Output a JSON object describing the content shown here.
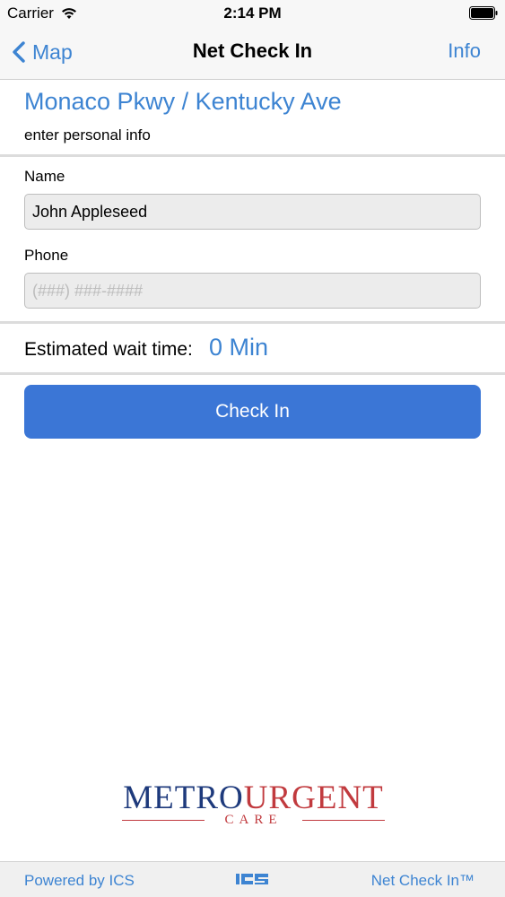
{
  "status_bar": {
    "carrier": "Carrier",
    "time": "2:14 PM",
    "wifi_icon": "wifi-icon",
    "battery_icon": "battery-icon"
  },
  "nav": {
    "back_label": "Map",
    "back_icon": "chevron-left-icon",
    "title": "Net Check In",
    "info_label": "Info"
  },
  "location": {
    "title": "Monaco Pkwy / Kentucky Ave",
    "subtitle": "enter personal info"
  },
  "form": {
    "name_label": "Name",
    "name_value": "John Appleseed",
    "phone_label": "Phone",
    "phone_value": "",
    "phone_placeholder": "(###) ###-####"
  },
  "wait": {
    "label": "Estimated wait time:",
    "value": "0 Min"
  },
  "checkin_button": "Check In",
  "logo": {
    "metro": "METRO",
    "urgent": "URGENT",
    "care": "CARE",
    "colors": {
      "metro": "#1e3a7c",
      "urgent": "#c13a3e"
    }
  },
  "footer": {
    "powered": "Powered by ICS",
    "ics_icon": "ics-logo-icon",
    "brand": "Net Check In™"
  },
  "colors": {
    "accent": "#3d84d2",
    "button": "#3b76d6"
  }
}
